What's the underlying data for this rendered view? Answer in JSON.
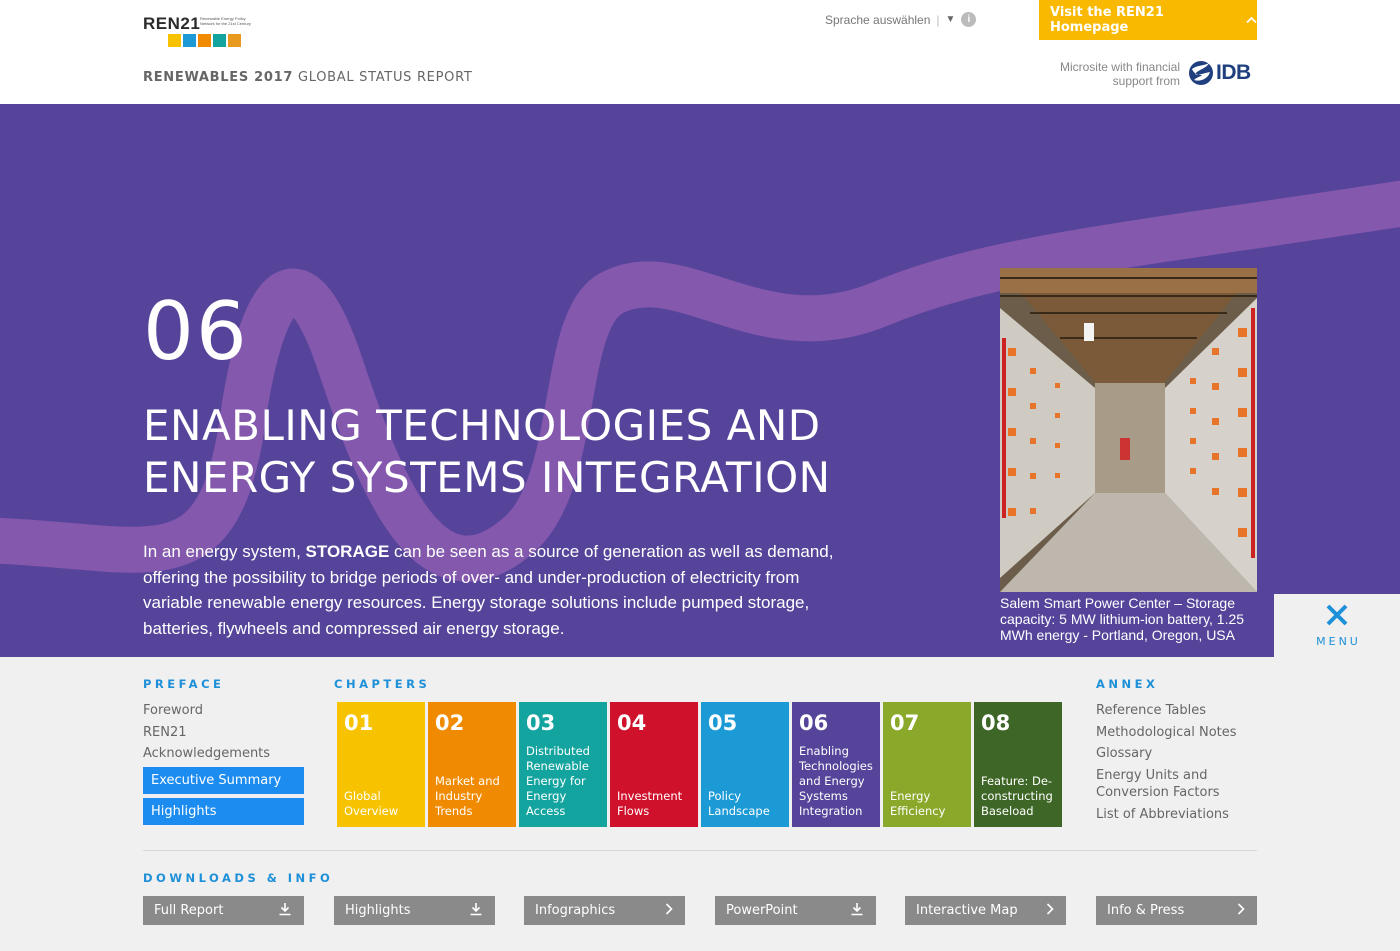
{
  "header": {
    "logo_word": "REN21",
    "logo_tagline": "Renewable Energy Policy Network for the 21st Century",
    "report_year": "RENEWABLES 2017",
    "report_name": "GLOBAL STATUS REPORT",
    "language_select": "Sprache auswählen",
    "visit_button": "Visit the REN21 Homepage",
    "microsite_text": "Microsite with financial support from",
    "idb_label": "IDB"
  },
  "hero": {
    "chapter_number": "06",
    "chapter_title": "ENABLING TECHNOLOGIES AND ENERGY SYSTEMS INTEGRATION",
    "intro_pre": "In an energy system, ",
    "intro_bold": "STORAGE",
    "intro_post": " can be seen as a source of generation as well as demand, offering the possibility to bridge periods of over- and under-production of electricity from variable renewable energy resources. Energy storage solutions include pumped storage, batteries, flywheels and compressed air energy storage.",
    "photo_caption": "Salem Smart Power Center – Storage capacity: 5 MW lithium-ion battery, 1.25 MWh energy - Portland, Oregon, USA",
    "colors": {
      "background": "#56449a",
      "swoosh": "#8b5cb0"
    }
  },
  "menu_toggle": {
    "label": "MENU"
  },
  "menu": {
    "preface": {
      "title": "PREFACE",
      "links": [
        "Foreword",
        "REN21",
        "Acknowledgements"
      ],
      "buttons": [
        "Executive Summary",
        "Highlights"
      ]
    },
    "chapters": {
      "title": "CHAPTERS",
      "items": [
        {
          "num": "01",
          "label": "Global Overview",
          "color": "#f7c300"
        },
        {
          "num": "02",
          "label": "Market and Industry Trends",
          "color": "#f08a00"
        },
        {
          "num": "03",
          "label": "Distributed Renewable Energy for Energy Access",
          "color": "#14a49f"
        },
        {
          "num": "04",
          "label": "Investment Flows",
          "color": "#d0112b"
        },
        {
          "num": "05",
          "label": "Policy Landscape",
          "color": "#1b9ad6"
        },
        {
          "num": "06",
          "label": "Enabling Technologies and Energy Systems Integration",
          "color": "#56449a"
        },
        {
          "num": "07",
          "label": "Energy Efficiency",
          "color": "#8aa82a"
        },
        {
          "num": "08",
          "label": "Feature: De-constructing Baseload",
          "color": "#3e6626"
        }
      ]
    },
    "annex": {
      "title": "ANNEX",
      "links": [
        "Reference Tables",
        "Methodological Notes",
        "Glossary",
        "Energy Units and Conversion Factors",
        "List of Abbreviations"
      ]
    },
    "downloads": {
      "title": "DOWNLOADS & INFO",
      "items": [
        {
          "label": "Full Report",
          "icon": "download-icon"
        },
        {
          "label": "Highlights",
          "icon": "download-icon"
        },
        {
          "label": "Infographics",
          "icon": "chevron-right-icon"
        },
        {
          "label": "PowerPoint",
          "icon": "download-icon"
        },
        {
          "label": "Interactive Map",
          "icon": "chevron-right-icon"
        },
        {
          "label": "Info & Press",
          "icon": "chevron-right-icon"
        }
      ]
    }
  }
}
